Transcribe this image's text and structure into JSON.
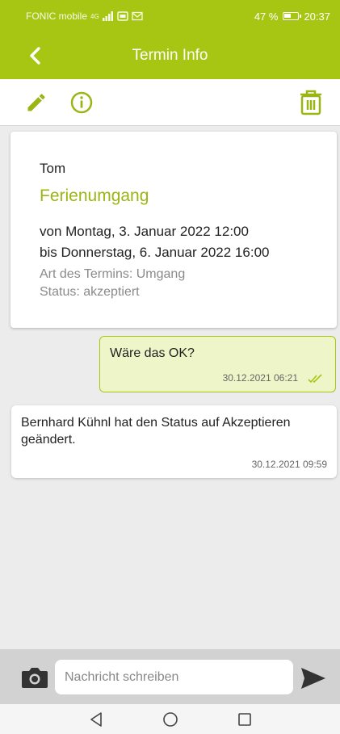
{
  "status_bar": {
    "carrier": "FONIC mobile",
    "network": "4G",
    "battery_percent": "47 %",
    "battery_level": 0.47,
    "time": "20:37"
  },
  "app_bar": {
    "title": "Termin Info",
    "background_color": "#a7c613",
    "back_icon": "chevron-left-icon"
  },
  "toolbar": {
    "edit_icon": "pencil-icon",
    "info_icon": "info-icon",
    "delete_icon": "trash-icon",
    "icon_color": "#9ab514"
  },
  "appointment": {
    "person": "Tom",
    "title": "Ferienumgang",
    "from": "von Montag, 3. Januar 2022 12:00",
    "to": "bis Donnerstag, 6. Januar 2022 16:00",
    "type": "Art des Termins: Umgang",
    "status": "Status: akzeptiert"
  },
  "messages": [
    {
      "direction": "outgoing",
      "text": "Wäre das OK?",
      "timestamp": "30.12.2021 06:21",
      "read_icon": "double-check-icon"
    },
    {
      "direction": "incoming",
      "text": "Bernhard Kühnl hat den Status auf Akzeptieren geändert.",
      "timestamp": "30.12.2021 09:59"
    }
  ],
  "composer": {
    "placeholder": "Nachricht schreiben",
    "value": "",
    "camera_icon": "camera-icon",
    "send_icon": "send-icon"
  },
  "nav_bar": {
    "back_icon": "triangle-back-icon",
    "home_icon": "circle-home-icon",
    "recents_icon": "square-recents-icon"
  }
}
